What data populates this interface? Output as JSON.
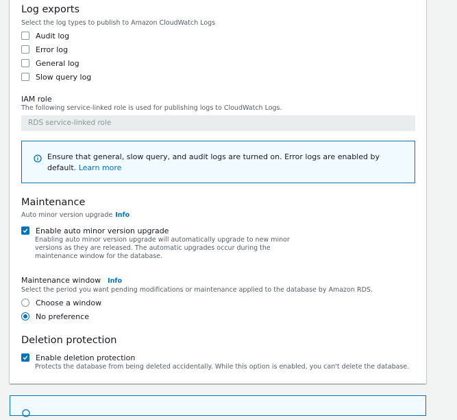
{
  "log_exports": {
    "title": "Log exports",
    "description": "Select the log types to publish to Amazon CloudWatch Logs",
    "options": [
      {
        "label": "Audit log",
        "checked": false
      },
      {
        "label": "Error log",
        "checked": false
      },
      {
        "label": "General log",
        "checked": false
      },
      {
        "label": "Slow query log",
        "checked": false
      }
    ]
  },
  "iam_role": {
    "label": "IAM role",
    "description": "The following service-linked role is used for publishing logs to CloudWatch Logs.",
    "value": "RDS service-linked role"
  },
  "alert": {
    "icon": "info-icon",
    "text": "Ensure that general, slow query, and audit logs are turned on. Error logs are enabled by default.",
    "link": "Learn more"
  },
  "maintenance": {
    "title": "Maintenance",
    "subtitle": "Auto minor version upgrade",
    "info": "Info",
    "auto_upgrade": {
      "label": "Enable auto minor version upgrade",
      "checked": true,
      "description": "Enabling auto minor version upgrade will automatically upgrade to new minor versions as they are released. The automatic upgrades occur during the maintenance window for the database."
    },
    "window": {
      "label": "Maintenance window",
      "info": "Info",
      "description": "Select the period you want pending modifications or maintenance applied to the database by Amazon RDS.",
      "options": [
        {
          "label": "Choose a window",
          "checked": false
        },
        {
          "label": "No preference",
          "checked": true
        }
      ]
    }
  },
  "deletion_protection": {
    "title": "Deletion protection",
    "label": "Enable deletion protection",
    "checked": true,
    "description": "Protects the database from being deleted accidentally. While this option is enabled, you can't delete the database."
  },
  "colors": {
    "accent": "#0073bb",
    "text": "#16191f",
    "muted": "#545b64",
    "alert_bg": "#f1faff",
    "background": "#f2f3f3"
  }
}
